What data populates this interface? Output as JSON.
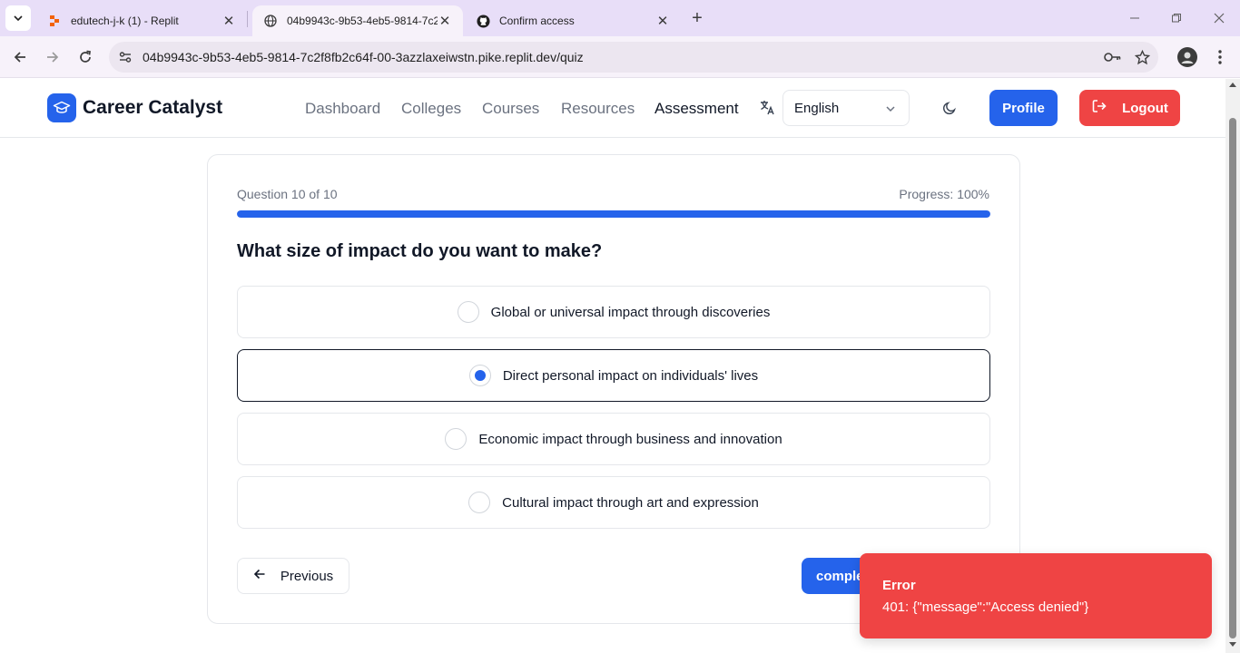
{
  "browser": {
    "tabs": [
      {
        "title": "edutech-j-k (1) - Replit",
        "active": false
      },
      {
        "title": "04b9943c-9b53-4eb5-9814-7c2",
        "active": true
      },
      {
        "title": "Confirm access",
        "active": false
      }
    ],
    "url": "04b9943c-9b53-4eb5-9814-7c2f8fb2c64f-00-3azzlaxeiwstn.pike.replit.dev/quiz"
  },
  "header": {
    "brand": "Career Catalyst",
    "nav": [
      "Dashboard",
      "Colleges",
      "Courses",
      "Resources",
      "Assessment"
    ],
    "active_nav": "Assessment",
    "language": "English",
    "profile_label": "Profile",
    "logout_label": "Logout"
  },
  "quiz": {
    "question_counter": "Question 10 of 10",
    "progress_label": "Progress: 100%",
    "progress_fraction": 1.0,
    "question": "What size of impact do you want to make?",
    "options": [
      {
        "label": "Global or universal impact through discoveries",
        "selected": false
      },
      {
        "label": "Direct personal impact on individuals' lives",
        "selected": true
      },
      {
        "label": "Economic impact through business and innovation",
        "selected": false
      },
      {
        "label": "Cultural impact through art and expression",
        "selected": false
      }
    ],
    "previous_label": "Previous",
    "complete_label": "comple"
  },
  "toast": {
    "title": "Error",
    "message": "401: {\"message\":\"Access denied\"}"
  },
  "colors": {
    "primary": "#2563eb",
    "danger": "#ef4444",
    "chrome_tabbar": "#e8def8"
  }
}
